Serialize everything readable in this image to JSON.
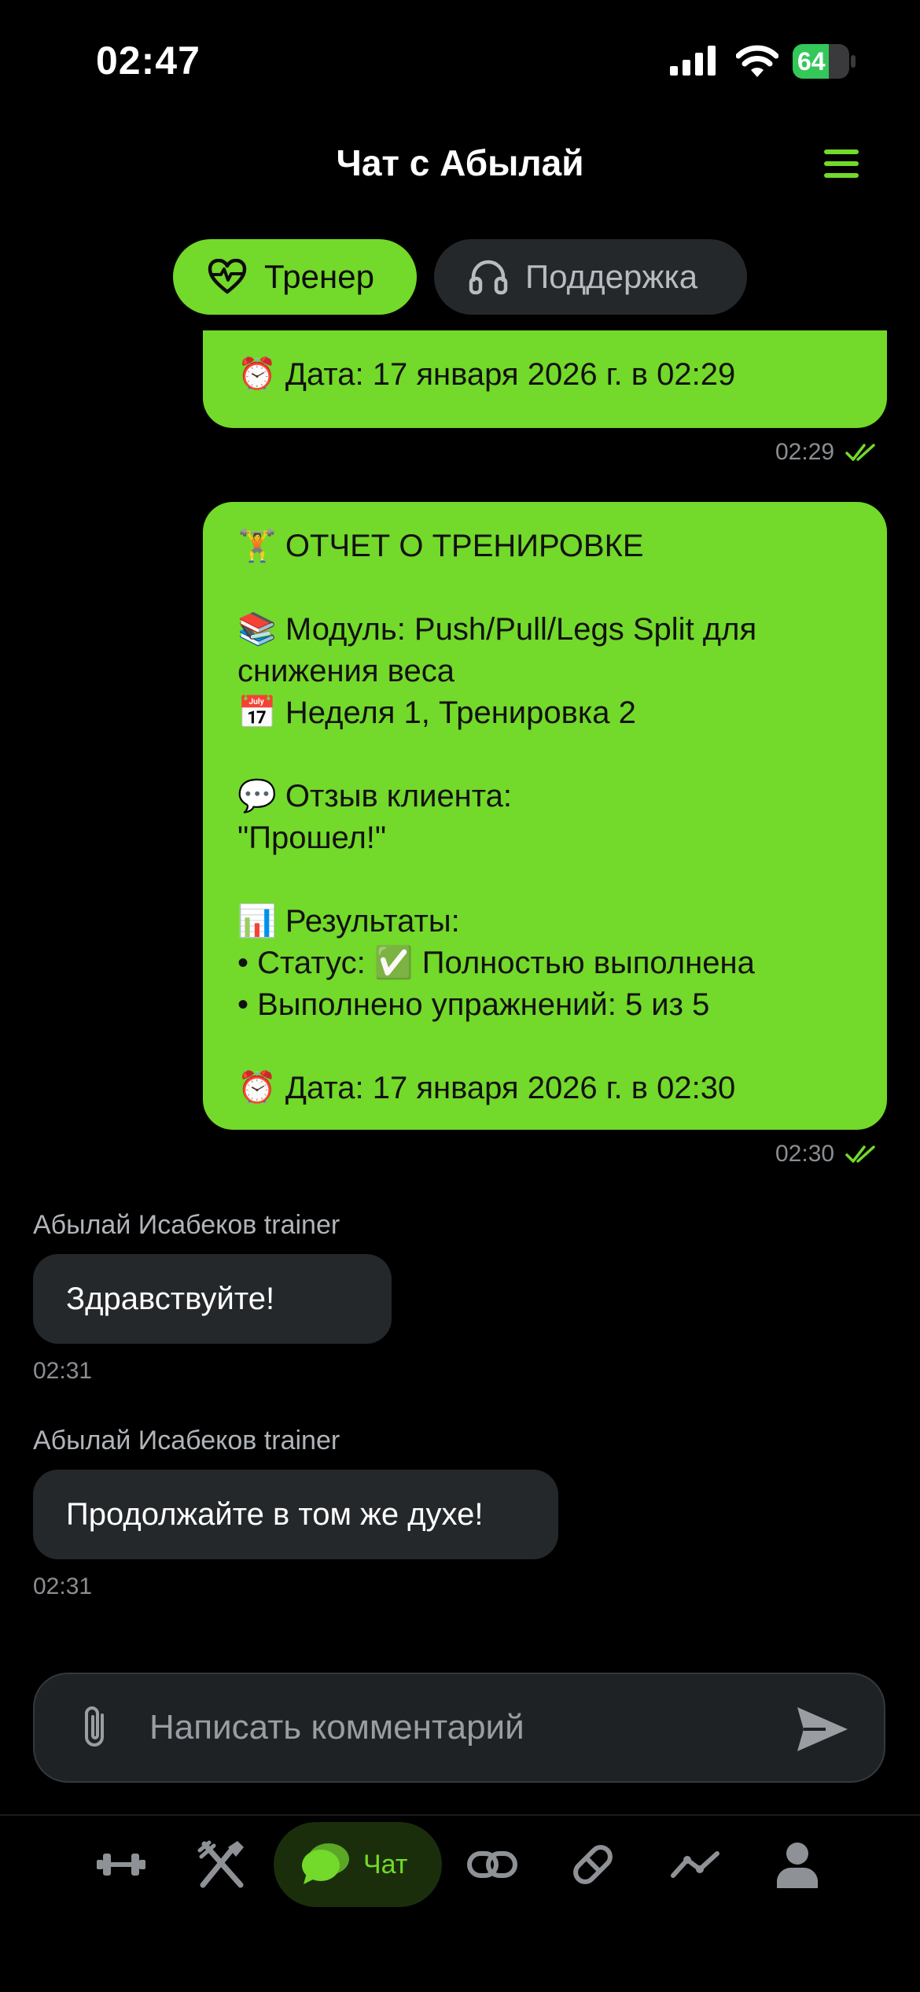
{
  "status_bar": {
    "time": "02:47",
    "battery": "64",
    "battery_level": 0.64
  },
  "header": {
    "title": "Чат с Абылай"
  },
  "tabs": [
    {
      "label": "Тренер",
      "active": true
    },
    {
      "label": "Поддержка",
      "active": false
    }
  ],
  "messages": {
    "partial": {
      "text": "⏰ Дата: 17 января 2026 г. в 02:29",
      "time": "02:29"
    },
    "report": {
      "lines": [
        "🏋️ ОТЧЕТ О ТРЕНИРОВКЕ",
        "",
        "📚 Модуль: Push/Pull/Legs Split для",
        "снижения веса",
        "📅 Неделя 1, Тренировка 2",
        "",
        "💬 Отзыв клиента:",
        "\"Прошел!\"",
        "",
        "📊 Результаты:",
        "• Статус: ✅ Полностью выполнена",
        "• Выполнено упражнений: 5 из 5",
        "",
        "⏰ Дата: 17 января 2026 г. в 02:30"
      ],
      "time": "02:30"
    },
    "incoming": [
      {
        "sender": "Абылай Исабеков trainer",
        "text": "Здравствуйте!",
        "time": "02:31"
      },
      {
        "sender": "Абылай Исабеков trainer",
        "text": "Продолжайте в том же духе!",
        "time": "02:31"
      }
    ]
  },
  "composer": {
    "placeholder": "Написать комментарий"
  },
  "nav": {
    "active_label": "Чат"
  },
  "colors": {
    "accent": "#73d92a",
    "background": "#000000",
    "incoming_bubble": "#24282b"
  },
  "icons": [
    "heart-pulse-icon",
    "headset-icon",
    "double-check-icon",
    "paperclip-icon",
    "send-icon",
    "dumbbell-icon",
    "fork-knife-icon",
    "chat-icon",
    "link-icon",
    "pill-icon",
    "chart-line-icon",
    "user-icon"
  ]
}
